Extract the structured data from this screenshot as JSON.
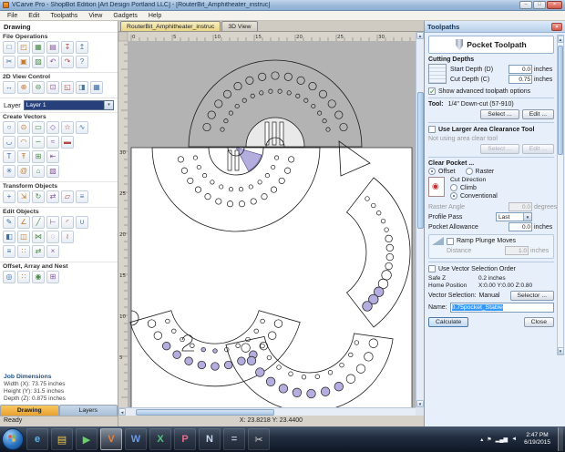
{
  "window": {
    "title": "VCarve Pro - ShopBot Edition [Art Design Portland LLC] - [RouterBit_Amphitheater_instruc]",
    "controls": {
      "minimize": "–",
      "maximize": "□",
      "close": "×"
    }
  },
  "menu": {
    "items": [
      "File",
      "Edit",
      "Toolpaths",
      "View",
      "Gadgets",
      "Help"
    ]
  },
  "doc_tabs": [
    {
      "label": "RouterBit_Amphitheater_instruc",
      "active": true
    },
    {
      "label": "3D View",
      "active": false
    }
  ],
  "toolbox": {
    "title": "Drawing",
    "file_ops": {
      "label": "File Operations",
      "rows": [
        [
          "new-file",
          "open-file",
          "save-file",
          "print-file",
          "import-vectors",
          "export-vectors"
        ],
        [
          "cut",
          "copy",
          "paste",
          "undo",
          "redo",
          "help"
        ]
      ]
    },
    "view_control": {
      "label": "2D View Control",
      "rows": [
        [
          "pan-view",
          "zoom-in",
          "zoom-out",
          "zoom-window",
          "zoom-extents",
          "zoom-selected",
          "snap-grid"
        ]
      ]
    },
    "layer": {
      "label": "Layer",
      "value": "Layer 1"
    },
    "create_vectors": {
      "label": "Create Vectors",
      "rows": [
        [
          "draw-circle",
          "draw-ellipse",
          "draw-rectangle",
          "draw-polygon",
          "draw-star",
          "draw-polyline"
        ],
        [
          "draw-curve",
          "draw-arc",
          "draw-freehand",
          "smooth-polyline",
          "draw-slot"
        ],
        [
          "draw-text",
          "text-on-curve",
          "text-in-box",
          "draw-dimension"
        ],
        [
          "draw-gear",
          "draw-spiral",
          "draw-keyhole",
          "paste-special"
        ]
      ]
    },
    "transform": {
      "label": "Transform Objects",
      "rows": [
        [
          "move-objects",
          "set-size",
          "rotate-objects",
          "mirror-objects",
          "distort-objects",
          "align-objects"
        ]
      ]
    },
    "edit": {
      "label": "Edit Objects",
      "rows": [
        [
          "node-editor",
          "measure-tool",
          "trim-vectors",
          "extend-vectors",
          "fillet-vectors",
          "weld-vectors"
        ],
        [
          "group-objects",
          "ungroup-objects",
          "join-vectors",
          "close-vectors",
          "fit-curves"
        ],
        [
          "align-tools",
          "space-evenly",
          "mirror-copy",
          "delete-object"
        ]
      ]
    },
    "offset_nest": {
      "label": "Offset, Array and Nest",
      "rows": [
        [
          "offset-vectors",
          "array-copy",
          "circular-copy",
          "nest-parts"
        ]
      ]
    },
    "job_dimensions": {
      "title": "Job Dimensions",
      "lines": [
        "Width (X): 73.75 inches",
        "Height (Y): 31.5 inches",
        "Depth (Z): 0.875 inches"
      ]
    },
    "tabs": [
      {
        "label": "Drawing",
        "active": true
      },
      {
        "label": "Layers",
        "active": false
      }
    ],
    "status": "Ready"
  },
  "canvas": {
    "ruler_top": [
      "0",
      "5",
      "10",
      "15",
      "20",
      "25",
      "30"
    ],
    "ruler_left": [
      "30",
      "25",
      "20",
      "15",
      "10",
      "5"
    ],
    "coords": "X: 23.8218   Y: 23.4400"
  },
  "toolpaths": {
    "title": "Toolpaths",
    "panel_title": "Pocket Toolpath",
    "cutting_depths": {
      "title": "Cutting Depths",
      "start_label": "Start Depth (D)",
      "start_value": "0.0",
      "cut_label": "Cut Depth (C)",
      "cut_value": "0.75",
      "units": "inches"
    },
    "advanced_checkbox": "Show advanced toolpath options",
    "tool": {
      "label": "Tool:",
      "name": "1/4\" Down-cut (57-910)",
      "select": "Select ...",
      "edit": "Edit ..."
    },
    "clearance": {
      "checkbox": "Use Larger Area Clearance Tool",
      "note": "Not using area clear tool",
      "select": "Select ...",
      "edit": "Edit ..."
    },
    "clear_pocket": {
      "title": "Clear Pocket ...",
      "offset": "Offset",
      "raster": "Raster",
      "cut_direction": "Cut Direction",
      "climb": "Climb",
      "conventional": "Conventional",
      "raster_angle_label": "Raster Angle",
      "raster_angle_value": "0.0",
      "raster_angle_units": "degrees",
      "profile_pass_label": "Profile Pass",
      "profile_pass_value": "Last"
    },
    "pocket_allowance": {
      "label": "Pocket Allowance",
      "value": "0.0",
      "units": "inches"
    },
    "ramp": {
      "label": "Ramp Plunge Moves",
      "distance_label": "Distance",
      "value": "1.0",
      "units": "inches"
    },
    "vector_order_checkbox": "Use Vector Selection Order",
    "safe_z": {
      "label": "Safe Z",
      "value": "0.2 inches"
    },
    "home": {
      "label": "Home Position",
      "value": "X:0.00 Y:0.00 Z:0.80"
    },
    "vector_selection": {
      "label": "Vector Selection:",
      "value": "Manual",
      "button": "Selector ..."
    },
    "name": {
      "label": "Name:",
      "value": "0.75pocket_Stable"
    },
    "calculate": "Calculate",
    "close": "Close"
  },
  "taskbar": {
    "icons": [
      {
        "name": "internet-explorer",
        "glyph": "e",
        "color": "#5ab4f0",
        "active": false
      },
      {
        "name": "windows-explorer",
        "glyph": "▤",
        "color": "#f0c84a",
        "active": false
      },
      {
        "name": "media-player",
        "glyph": "▶",
        "color": "#6ad06a",
        "active": false
      },
      {
        "name": "vcarve-pro",
        "glyph": "V",
        "color": "#f08030",
        "active": true
      },
      {
        "name": "word",
        "glyph": "W",
        "color": "#6a9ae8",
        "active": false
      },
      {
        "name": "excel",
        "glyph": "X",
        "color": "#58c080",
        "active": false
      },
      {
        "name": "paint",
        "glyph": "P",
        "color": "#e86a8a",
        "active": false
      },
      {
        "name": "notepad",
        "glyph": "N",
        "color": "#c8d8f0",
        "active": false
      },
      {
        "name": "calculator",
        "glyph": "=",
        "color": "#b0b8c8",
        "active": false
      },
      {
        "name": "snipping-tool",
        "glyph": "✂",
        "color": "#d8d8d8",
        "active": false
      }
    ],
    "tray": [
      {
        "name": "hidden-icons-chevron",
        "glyph": "▴"
      },
      {
        "name": "action-center-icon",
        "glyph": "⚑"
      },
      {
        "name": "network-icon",
        "glyph": "▂▄▆"
      },
      {
        "name": "volume-icon",
        "glyph": "◄"
      }
    ],
    "clock": {
      "time": "2:47 PM",
      "date": "6/19/2015"
    }
  },
  "icon_glyphs": {
    "new-file": "□",
    "open-file": "◰",
    "save-file": "▦",
    "print-file": "▤",
    "import-vectors": "↧",
    "export-vectors": "↥",
    "cut": "✂",
    "copy": "▣",
    "paste": "▨",
    "undo": "↶",
    "redo": "↷",
    "help": "?",
    "pan-view": "↔",
    "zoom-in": "⊕",
    "zoom-out": "⊖",
    "zoom-window": "⊡",
    "zoom-extents": "◱",
    "zoom-selected": "◨",
    "snap-grid": "▦",
    "draw-circle": "○",
    "draw-ellipse": "⊙",
    "draw-rectangle": "▭",
    "draw-polygon": "◇",
    "draw-star": "☆",
    "draw-polyline": "∿",
    "draw-curve": "◡",
    "draw-arc": "◠",
    "draw-freehand": "∽",
    "smooth-polyline": "≈",
    "draw-slot": "▬",
    "draw-text": "T",
    "text-on-curve": "Ŧ",
    "text-in-box": "⊞",
    "draw-dimension": "⇤",
    "draw-gear": "✳",
    "draw-spiral": "@",
    "draw-keyhole": "⌂",
    "paste-special": "▧",
    "move-objects": "+",
    "set-size": "⇲",
    "rotate-objects": "↻",
    "mirror-objects": "⇄",
    "distort-objects": "▱",
    "align-objects": "≡",
    "node-editor": "✎",
    "measure-tool": "∠",
    "trim-vectors": "╱",
    "extend-vectors": "⊢",
    "fillet-vectors": "◜",
    "weld-vectors": "∪",
    "group-objects": "◧",
    "ungroup-objects": "◫",
    "join-vectors": "⋈",
    "close-vectors": "◌",
    "fit-curves": "≀",
    "align-tools": "≡",
    "space-evenly": "∷",
    "mirror-copy": "⇄",
    "delete-object": "×",
    "offset-vectors": "◎",
    "array-copy": "∷",
    "circular-copy": "◉",
    "nest-parts": "⊞"
  },
  "icon_palette": [
    "#3a6ea5",
    "#c07830",
    "#4a8a4a",
    "#8a5aa0",
    "#b04848",
    "#4a7a9a"
  ],
  "colors": {
    "accent": "#3a6ea5",
    "lavender": "#b4aede",
    "selection": "#3399ff"
  }
}
